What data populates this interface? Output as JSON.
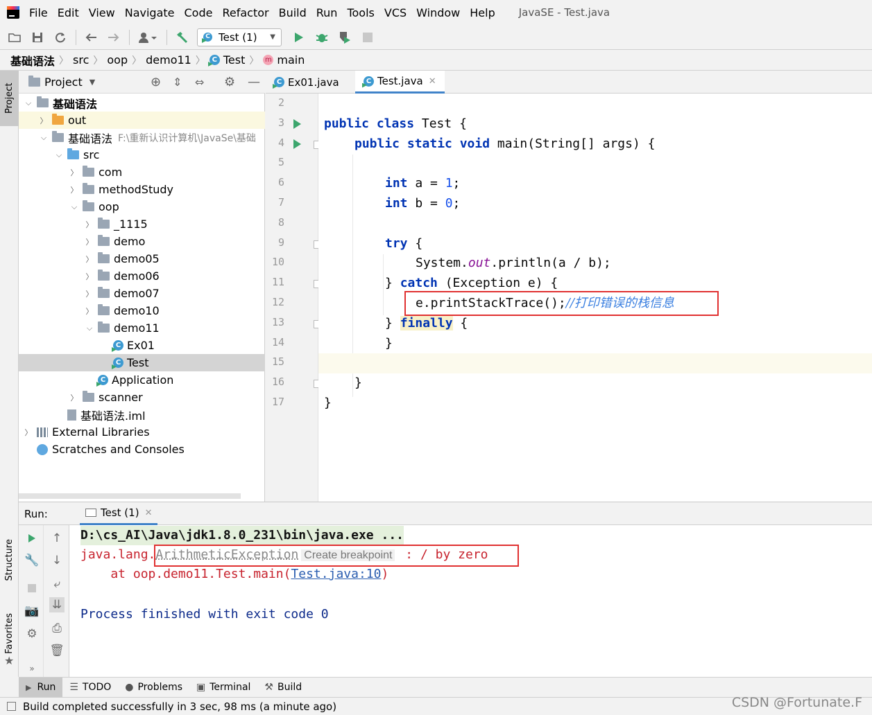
{
  "menubar": {
    "items": [
      "File",
      "Edit",
      "View",
      "Navigate",
      "Code",
      "Refactor",
      "Build",
      "Run",
      "Tools",
      "VCS",
      "Window",
      "Help"
    ],
    "window_title": "JavaSE - Test.java"
  },
  "toolbar": {
    "run_config": "Test (1)",
    "icons": [
      "folder-open-icon",
      "save-icon",
      "sync-icon",
      "back-icon",
      "forward-icon",
      "user-icon",
      "build-hammer-icon",
      "run-icon",
      "debug-icon",
      "coverage-icon",
      "stop-icon"
    ]
  },
  "breadcrumb": [
    "基础语法",
    "src",
    "oop",
    "demo11",
    "Test",
    "main"
  ],
  "stripe": {
    "project": "Project",
    "structure": "Structure",
    "favorites": "Favorites"
  },
  "project_panel": {
    "title": "Project",
    "tree": [
      {
        "label": "基础语法",
        "indent": 0,
        "arrow": "down",
        "type": "module",
        "bold": true
      },
      {
        "label": "out",
        "indent": 1,
        "arrow": "right",
        "type": "out"
      },
      {
        "label": "基础语法",
        "path": "F:\\重新认识计算机\\JavaSe\\基础",
        "indent": 1,
        "arrow": "down",
        "type": "module"
      },
      {
        "label": "src",
        "indent": 2,
        "arrow": "down",
        "type": "src"
      },
      {
        "label": "com",
        "indent": 3,
        "arrow": "right",
        "type": "pkg"
      },
      {
        "label": "methodStudy",
        "indent": 3,
        "arrow": "right",
        "type": "pkg"
      },
      {
        "label": "oop",
        "indent": 3,
        "arrow": "down",
        "type": "pkg"
      },
      {
        "label": "_1115",
        "indent": 4,
        "arrow": "right",
        "type": "pkg"
      },
      {
        "label": "demo",
        "indent": 4,
        "arrow": "right",
        "type": "pkg"
      },
      {
        "label": "demo05",
        "indent": 4,
        "arrow": "right",
        "type": "pkg"
      },
      {
        "label": "demo06",
        "indent": 4,
        "arrow": "right",
        "type": "pkg"
      },
      {
        "label": "demo07",
        "indent": 4,
        "arrow": "right",
        "type": "pkg"
      },
      {
        "label": "demo10",
        "indent": 4,
        "arrow": "right",
        "type": "pkg"
      },
      {
        "label": "demo11",
        "indent": 4,
        "arrow": "down",
        "type": "pkg"
      },
      {
        "label": "Ex01",
        "indent": 5,
        "arrow": "",
        "type": "class"
      },
      {
        "label": "Test",
        "indent": 5,
        "arrow": "",
        "type": "class",
        "selected": true
      },
      {
        "label": "Application",
        "indent": 4,
        "arrow": "",
        "type": "class"
      },
      {
        "label": "scanner",
        "indent": 3,
        "arrow": "right",
        "type": "pkg"
      },
      {
        "label": "基础语法.iml",
        "indent": 2,
        "arrow": "",
        "type": "iml"
      },
      {
        "label": "External Libraries",
        "indent": 0,
        "arrow": "right",
        "type": "lib"
      },
      {
        "label": "Scratches and Consoles",
        "indent": 0,
        "arrow": "",
        "type": "scratch"
      }
    ]
  },
  "editor": {
    "tabs": [
      {
        "label": "Ex01.java"
      },
      {
        "label": "Test.java",
        "active": true
      }
    ],
    "line_numbers": [
      "2",
      "3",
      "4",
      "5",
      "6",
      "7",
      "8",
      "9",
      "10",
      "11",
      "12",
      "13",
      "14",
      "15",
      "16",
      "17"
    ],
    "code": {
      "l3": [
        "public class",
        " Test {"
      ],
      "l4": [
        "public static void",
        " main(String[] args) {"
      ],
      "l6": [
        "int",
        " a = ",
        "1",
        ";"
      ],
      "l7": [
        "int",
        " b = ",
        "0",
        ";"
      ],
      "l9": [
        "try",
        " {"
      ],
      "l10": [
        "System.",
        "out",
        ".println(a / b);"
      ],
      "l11": [
        "} ",
        "catch",
        " (Exception e) {"
      ],
      "l12": [
        "e.printStackTrace();",
        "//打印错误的栈信息"
      ],
      "l13": [
        "} ",
        "finally",
        " {"
      ],
      "l14": "}",
      "l16": "}",
      "l17": "}"
    }
  },
  "run_panel": {
    "label": "Run:",
    "tab": "Test (1)",
    "console": {
      "line1": "D:\\cs_AI\\Java\\jdk1.8.0_231\\bin\\java.exe ...",
      "line2_prefix": "java.lang.",
      "line2_exception": "ArithmeticException",
      "line2_hint": "Create breakpoint",
      "line2_suffix": " : / by zero",
      "line3_prefix": "    at oop.demo11.Test.main(",
      "line3_link": "Test.java:10",
      "line3_suffix": ")",
      "line5": "Process finished with exit code 0"
    }
  },
  "bottom_tabs": [
    "Run",
    "TODO",
    "Problems",
    "Terminal",
    "Build"
  ],
  "status_bar": "Build completed successfully in 3 sec, 98 ms (a minute ago)",
  "watermark": "CSDN @Fortunate.F",
  "colors": {
    "keyword": "#0033b3",
    "number": "#1750eb",
    "comment": "#3a7fe0",
    "error_red": "#c7222d",
    "highlight_box": "#e03030",
    "link": "#2a5db0"
  }
}
